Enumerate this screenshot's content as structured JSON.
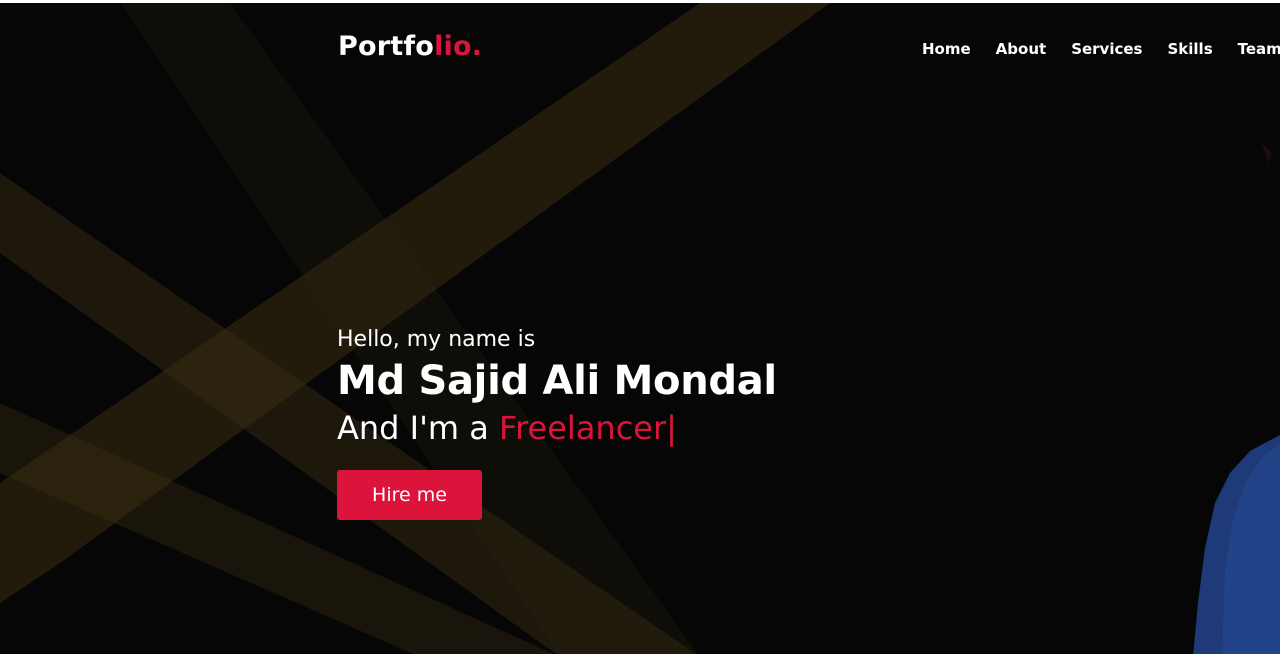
{
  "brand": {
    "logo_main": "Portfo",
    "logo_accent": "lio."
  },
  "nav": {
    "items": [
      {
        "label": "Home"
      },
      {
        "label": "About"
      },
      {
        "label": "Services"
      },
      {
        "label": "Skills"
      },
      {
        "label": "Teams"
      }
    ]
  },
  "hero": {
    "greeting": "Hello, my name is",
    "name": "Md Sajid Ali Mondal",
    "role_prefix": "And I'm a ",
    "role": "Freelancer",
    "cursor": "|",
    "cta_label": "Hire me"
  },
  "colors": {
    "accent": "#dc143c",
    "background": "#060606",
    "text": "#ffffff",
    "light_beams": "#3a2e12",
    "portrait_suit": "#1f3a78"
  },
  "icons": {
    "background": "golden-light-beams",
    "portrait": "person-in-blue-suit"
  }
}
